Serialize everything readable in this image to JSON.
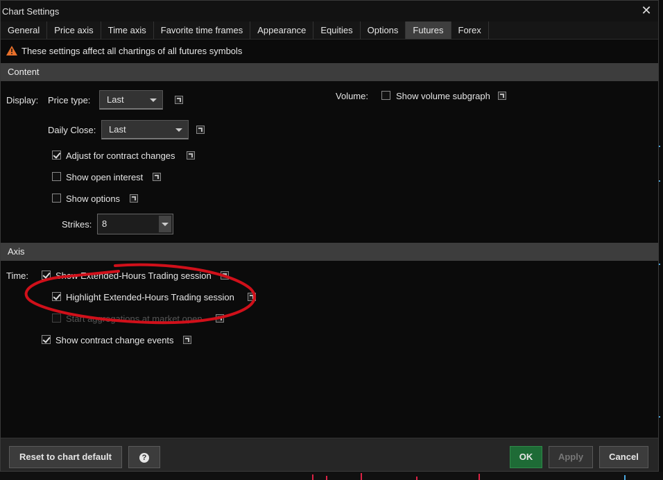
{
  "window": {
    "title": "Chart Settings",
    "close_icon": "close-icon"
  },
  "tabs": [
    {
      "label": "General"
    },
    {
      "label": "Price axis"
    },
    {
      "label": "Time axis"
    },
    {
      "label": "Favorite time frames"
    },
    {
      "label": "Appearance"
    },
    {
      "label": "Equities"
    },
    {
      "label": "Options"
    },
    {
      "label": "Futures",
      "active": true
    },
    {
      "label": "Forex"
    }
  ],
  "notice": {
    "text": "These settings affect all chartings of all futures symbols",
    "icon": "warning-icon",
    "color": "#e8702a"
  },
  "content": {
    "header": "Content",
    "display_label": "Display:",
    "price_type_label": "Price type:",
    "price_type_value": "Last",
    "daily_close_label": "Daily Close:",
    "daily_close_value": "Last",
    "adjust_contract": {
      "label": "Adjust for contract changes",
      "checked": true
    },
    "open_interest": {
      "label": "Show open interest",
      "checked": false
    },
    "show_options": {
      "label": "Show options",
      "checked": false
    },
    "strikes_label": "Strikes:",
    "strikes_value": "8",
    "volume_label": "Volume:",
    "volume_subgraph": {
      "label": "Show volume subgraph",
      "checked": false
    }
  },
  "axis": {
    "header": "Axis",
    "time_label": "Time:",
    "extended_hours": {
      "label": "Show Extended-Hours Trading session",
      "checked": true
    },
    "highlight_extended": {
      "label": "Highlight Extended-Hours Trading session",
      "checked": true
    },
    "start_aggregations": {
      "label": "Start aggregations at market open",
      "checked": false,
      "disabled": true
    },
    "contract_change_events": {
      "label": "Show contract change events",
      "checked": true
    }
  },
  "footer": {
    "reset_label": "Reset to chart default",
    "help_label": "?",
    "ok_label": "OK",
    "apply_label": "Apply",
    "cancel_label": "Cancel"
  },
  "colors": {
    "annotation": "#d0101a",
    "ok_button": "#1e6b36",
    "section_header": "#3d3d3d"
  }
}
